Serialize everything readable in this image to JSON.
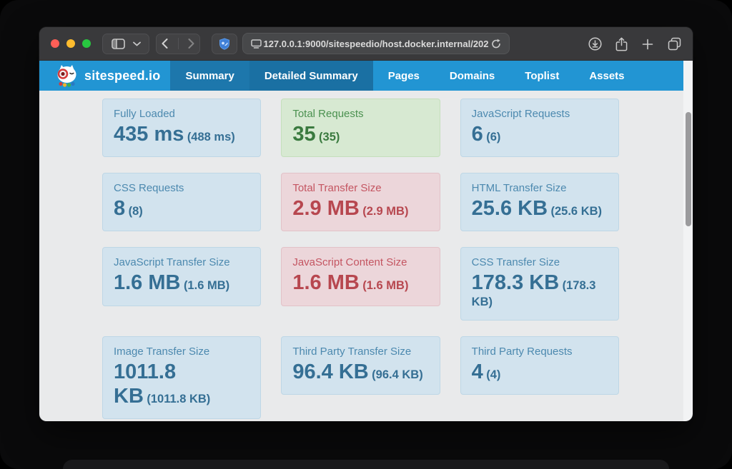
{
  "browser": {
    "url": "127.0.0.1:9000/sitespeedio/host.docker.internal/202",
    "toolbar_icons": [
      "sidebar-toggle",
      "chevron-down",
      "back",
      "forward",
      "extension-shield",
      "viewport",
      "reload",
      "downloads",
      "share",
      "new-tab",
      "tab-overview"
    ],
    "traffic_lights": [
      "close",
      "minimize",
      "zoom"
    ]
  },
  "nav": {
    "brand": "sitespeed.io",
    "items": [
      {
        "label": "Summary",
        "dark": true,
        "active": false
      },
      {
        "label": "Detailed Summary",
        "dark": true,
        "active": true
      },
      {
        "label": "Pages",
        "dark": false,
        "active": false
      },
      {
        "label": "Domains",
        "dark": false,
        "active": false
      },
      {
        "label": "Toplist",
        "dark": false,
        "active": false
      },
      {
        "label": "Assets",
        "dark": false,
        "active": false
      }
    ]
  },
  "cards": [
    {
      "label": "Fully Loaded",
      "value": "435 ms",
      "secondary": "(488 ms)",
      "variant": "info"
    },
    {
      "label": "Total Requests",
      "value": "35",
      "secondary": "(35)",
      "variant": "success"
    },
    {
      "label": "JavaScript Requests",
      "value": "6",
      "secondary": "(6)",
      "variant": "info"
    },
    {
      "label": "CSS Requests",
      "value": "8",
      "secondary": "(8)",
      "variant": "info"
    },
    {
      "label": "Total Transfer Size",
      "value": "2.9 MB",
      "secondary": "(2.9 MB)",
      "variant": "danger"
    },
    {
      "label": "HTML Transfer Size",
      "value": "25.6 KB",
      "secondary": "(25.6 KB)",
      "variant": "info"
    },
    {
      "label": "JavaScript Transfer Size",
      "value": "1.6 MB",
      "secondary": "(1.6 MB)",
      "variant": "info"
    },
    {
      "label": "JavaScript Content Size",
      "value": "1.6 MB",
      "secondary": "(1.6 MB)",
      "variant": "danger"
    },
    {
      "label": "CSS Transfer Size",
      "value": "178.3 KB",
      "secondary": "(178.3 KB)",
      "secondary_lines": [
        "(178.3",
        "KB)"
      ],
      "variant": "info"
    },
    {
      "label": "Image Transfer Size",
      "value": "1011.8 KB",
      "value_lines": [
        "1011.8",
        "KB"
      ],
      "secondary": "(1011.8 KB)",
      "variant": "info"
    },
    {
      "label": "Third Party Transfer Size",
      "value": "96.4 KB",
      "secondary": "(96.4 KB)",
      "variant": "info"
    },
    {
      "label": "Third Party Requests",
      "value": "4",
      "secondary": "(4)",
      "variant": "info"
    }
  ],
  "colors": {
    "navbar": "#2295d3",
    "nav_active": "#1a70a3",
    "info_text": "#356f94",
    "success_text": "#3a7a3f",
    "danger_text": "#b7474f",
    "content_bg": "#e9eaeb"
  }
}
